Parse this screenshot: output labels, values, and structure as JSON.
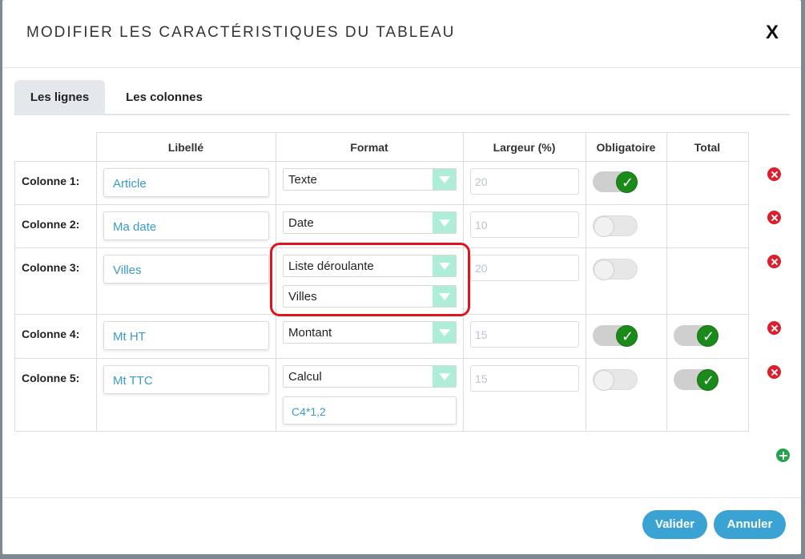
{
  "dialog": {
    "title": "MODIFIER LES CARACTÉRISTIQUES DU TABLEAU",
    "close_label": "X"
  },
  "tabs": [
    {
      "label": "Les lignes",
      "active": true
    },
    {
      "label": "Les colonnes",
      "active": false
    }
  ],
  "table": {
    "headers": [
      "Libellé",
      "Format",
      "Largeur (%)",
      "Obligatoire",
      "Total"
    ],
    "rows": [
      {
        "label": "Colonne 1:",
        "libelle": "Article",
        "format": "Texte",
        "largeur": "20",
        "obligatoire": true,
        "total": null
      },
      {
        "label": "Colonne 2:",
        "libelle": "Ma date",
        "format": "Date",
        "largeur": "10",
        "obligatoire": false,
        "total": null
      },
      {
        "label": "Colonne 3:",
        "libelle": "Villes",
        "format": "Liste déroulante",
        "liste": "Villes",
        "largeur": "20",
        "obligatoire": false,
        "total": null
      },
      {
        "label": "Colonne 4:",
        "libelle": "Mt HT",
        "format": "Montant",
        "largeur": "15",
        "obligatoire": true,
        "total": true
      },
      {
        "label": "Colonne 5:",
        "libelle": "Mt TTC",
        "format": "Calcul",
        "formule": "C4*1,2",
        "largeur": "15",
        "obligatoire": false,
        "total": true
      }
    ]
  },
  "buttons": {
    "valider": "Valider",
    "annuler": "Annuler"
  },
  "colors": {
    "accent": "#3aa3d3",
    "select_arrow": "#aeeed8",
    "toggle_on": "#1a8a1a",
    "delete": "#dd1f2d",
    "add": "#22a44a",
    "highlight": "#e0141e"
  }
}
